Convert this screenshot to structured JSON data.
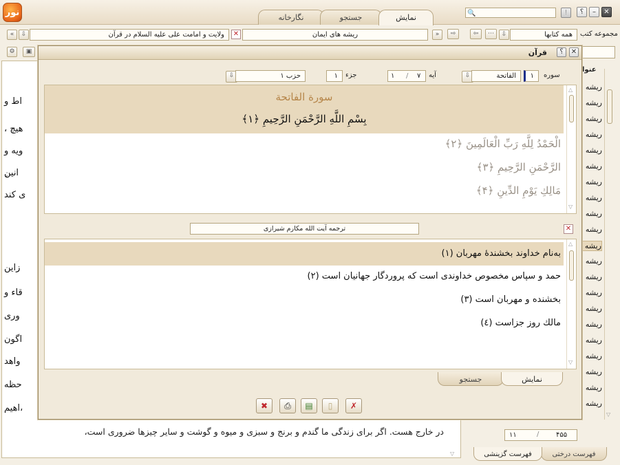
{
  "app": {
    "logo_glyph": "نور"
  },
  "window_buttons": {
    "close": "✕",
    "minimize": "–",
    "help": "؟",
    "alert": "!"
  },
  "top_tabs": [
    "نمایش",
    "جستجو",
    "نگارخانه"
  ],
  "breadcrumb": {
    "left_text": "ولایت و امامت علی علیه السلام در قرآن",
    "right_text": "ریشه های ایمان",
    "book_select": "همه کتابها",
    "book_label": "مجموعه کتب"
  },
  "right_panel": {
    "header_fragment": "عنوا",
    "items": [
      "ریشه",
      "ریشه",
      "ریشه",
      "ریشه",
      "ریشه",
      "ریشه",
      "ریشه",
      "ریشه",
      "ریشه",
      "ریشه",
      "ریشه",
      "ریشه",
      "ریشه",
      "ریشه",
      "ریشه",
      "ریشه",
      "ریشه",
      "ریشه",
      "ریشه",
      "ریشه",
      "ریشه"
    ],
    "page_a": "۴۵۵",
    "page_b": "۱۱",
    "bottom_tabs": [
      "فهرست درختی",
      "فهرست گزینشی"
    ]
  },
  "background_text": {
    "fragments": [
      "اط و",
      "، هیچ",
      "ویه و",
      "ِانین",
      "ی کند",
      "زاین",
      "قاء و",
      "وری",
      "اگون",
      "واهد",
      "حظه",
      "اهیم،"
    ],
    "bottom_line": "در خارج هست. اگر برای زندگی ما گندم و برنج و سبزی و میوه و گوشت و سایر چیزها ضروری است،"
  },
  "dialog": {
    "title": "قرآن",
    "controls": {
      "sura_label": "سوره",
      "sura_number": "۱",
      "sura_name": "الفاتحة",
      "aya_label": "آیه",
      "aya_from": "۱",
      "aya_to": "۷",
      "juz_label": "جزء",
      "juz_value": "۱",
      "hizb_value": "حزب ۱"
    },
    "quran": {
      "sura_title": "سورة الفاتحة",
      "verses": [
        "بِسْمِ اللَّهِ الرَّحْمَنِ الرَّحِيمِ ﴿۱﴾",
        "الْحَمْدُ لِلَّهِ رَبِّ الْعَالَمِينَ ﴿۲﴾",
        "الرَّحْمَنِ الرَّحِيمِ ﴿۳﴾",
        "مَالِكِ يَوْمِ الدِّينِ ﴿۴﴾"
      ]
    },
    "translation": {
      "translator": "ترجمه آیت الله مکارم شیرازی",
      "lines": [
        "به‌نام خداوند بخشندهٔ مهربان (۱)",
        "حمد و سپاس مخصوص خداوندی است که پروردگار جهانیان است (۲)",
        "بخشنده و مهربان است (۳)",
        "مالك روز جزاست (٤)"
      ]
    },
    "tabs": [
      "نمایش",
      "جستجو"
    ]
  },
  "colors": {
    "highlight": "#e8d9bd",
    "accent_close": "#c0272d",
    "arabic_faded": "#9a9288"
  }
}
